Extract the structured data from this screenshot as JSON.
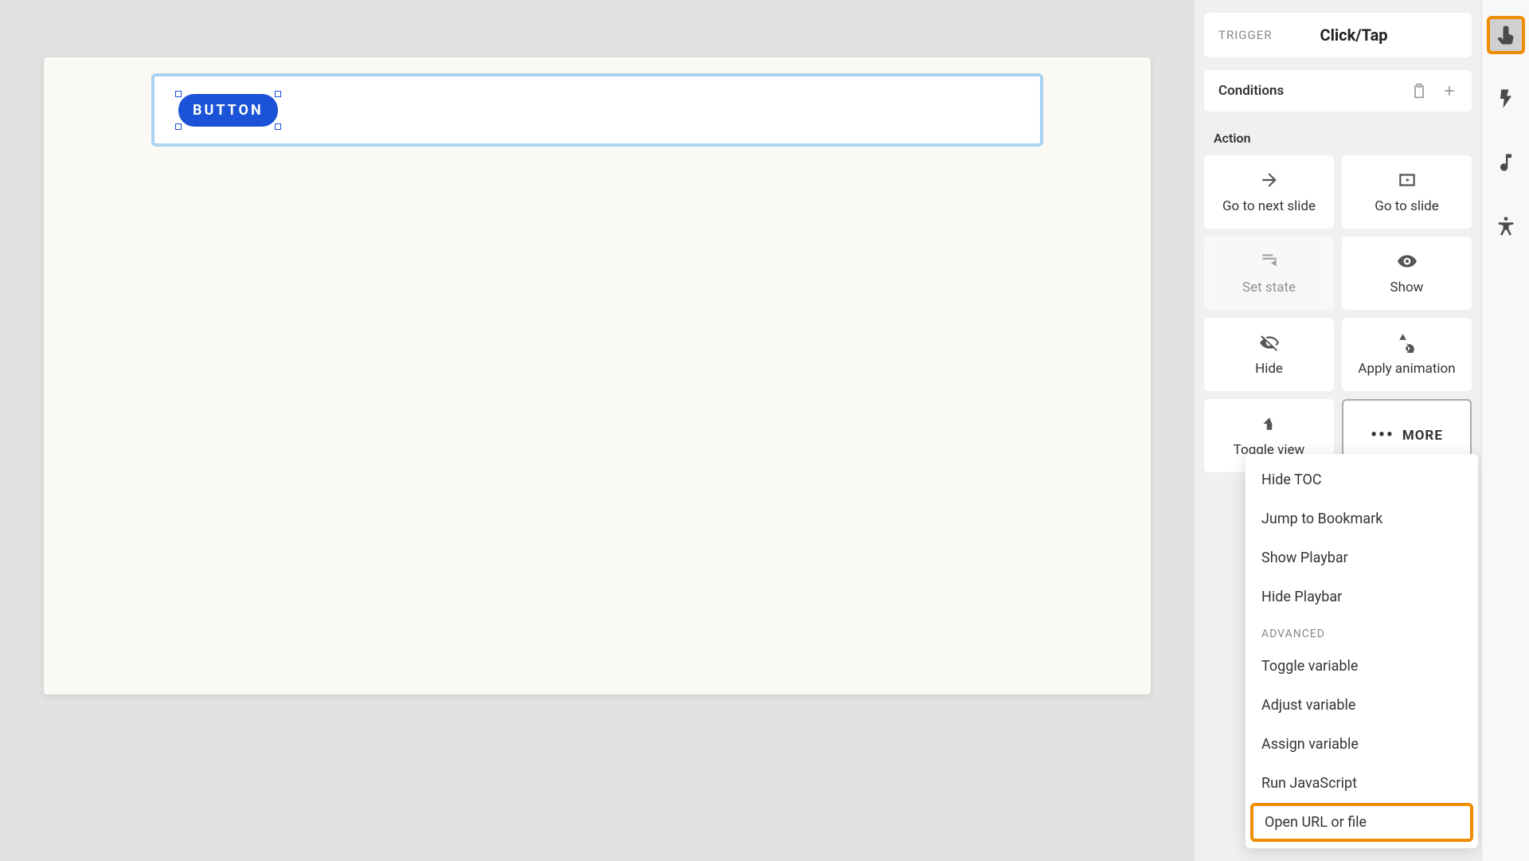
{
  "canvas": {
    "button_text": "BUTTON"
  },
  "panel": {
    "trigger_label": "TRIGGER",
    "trigger_value": "Click/Tap",
    "conditions_label": "Conditions",
    "action_label": "Action",
    "actions": {
      "next_slide": "Go to next slide",
      "go_to_slide": "Go to slide",
      "set_state": "Set state",
      "show": "Show",
      "hide": "Hide",
      "apply_animation": "Apply animation",
      "toggle_view": "Toggle view",
      "more": "MORE"
    },
    "dropdown": {
      "hide_toc": "Hide TOC",
      "jump_bookmark": "Jump to Bookmark",
      "show_playbar": "Show Playbar",
      "hide_playbar": "Hide Playbar",
      "advanced_header": "ADVANCED",
      "toggle_variable": "Toggle variable",
      "adjust_variable": "Adjust variable",
      "assign_variable": "Assign variable",
      "run_js": "Run JavaScript",
      "open_url": "Open URL or file"
    }
  }
}
